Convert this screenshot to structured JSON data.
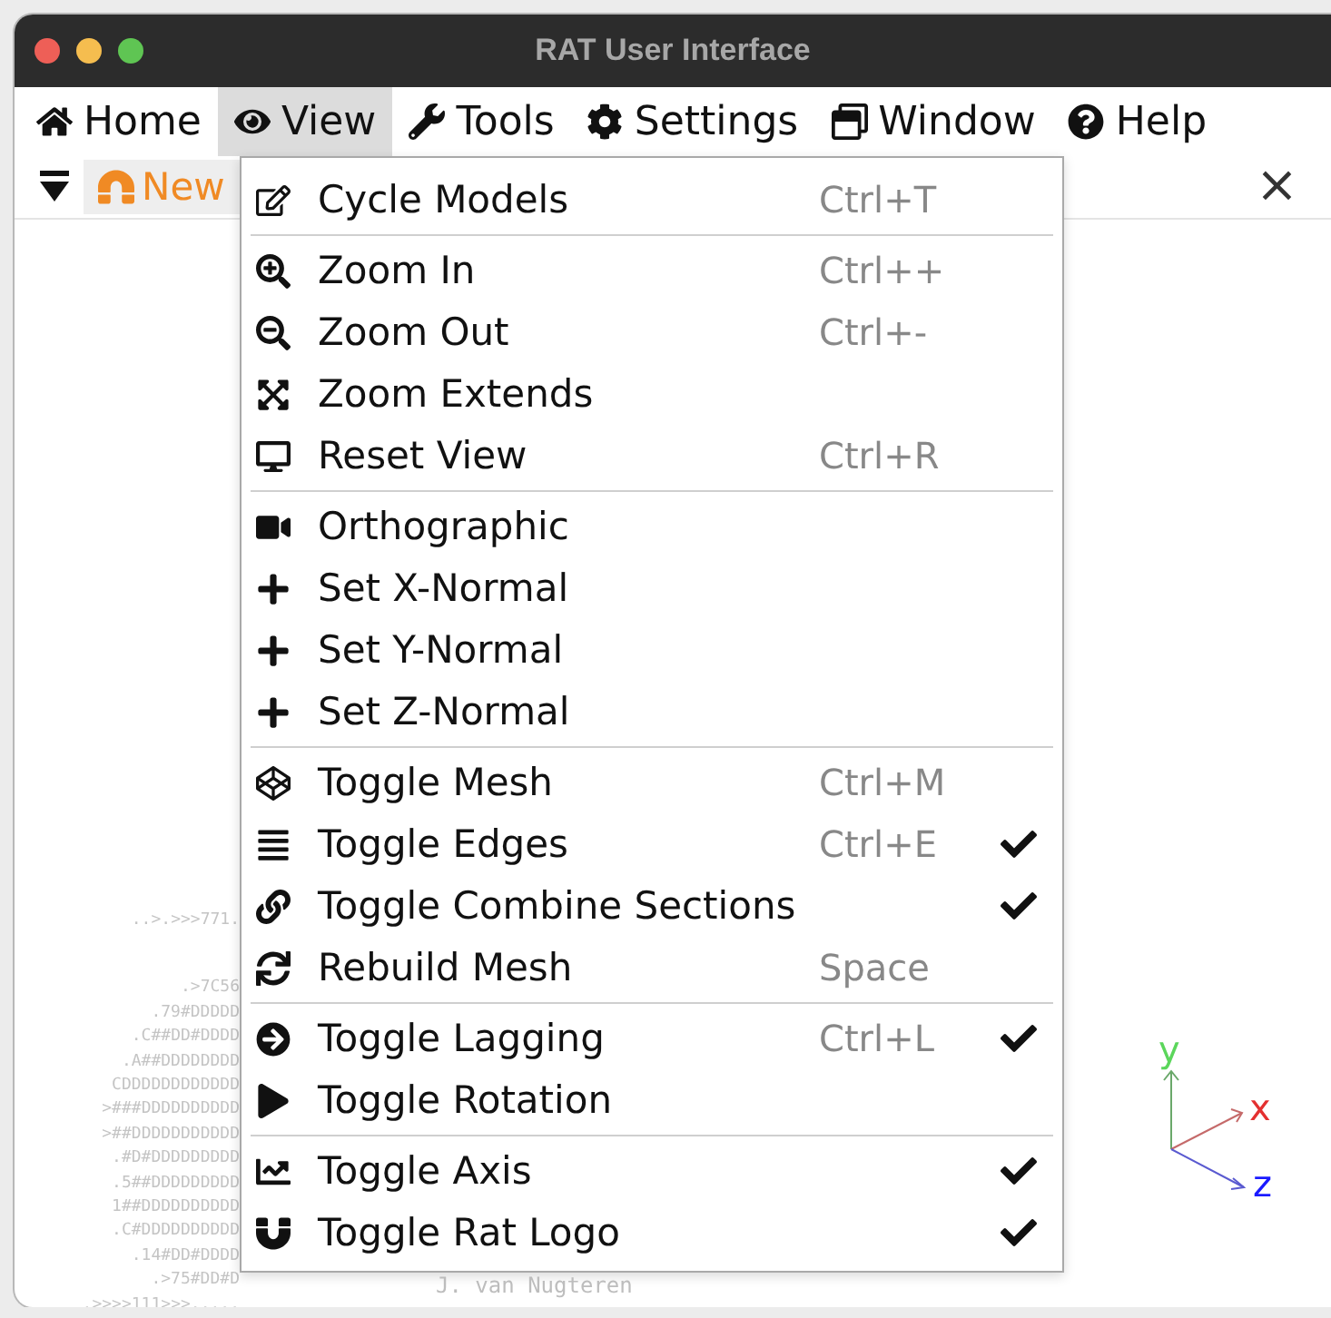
{
  "window": {
    "title": "RAT User Interface"
  },
  "menubar": [
    {
      "label": "Home",
      "selected": false
    },
    {
      "label": "View",
      "selected": true
    },
    {
      "label": "Tools",
      "selected": false
    },
    {
      "label": "Settings",
      "selected": false
    },
    {
      "label": "Window",
      "selected": false
    },
    {
      "label": "Help",
      "selected": false
    }
  ],
  "tabs": [
    {
      "label": "New",
      "selected": true
    }
  ],
  "close_label": "×",
  "background_art": [
    "..>.>>>771.",
    ".>7C56",
    ".79#DDDDD",
    ".C##DD#DDDD",
    ".A##DDDDDDDD",
    "CDDDDDDDDDDDD",
    ">###DDDDDDDDDD",
    ">##DDDDDDDDDDD",
    ".#D#DDDDDDDDD",
    ".5##DDDDDDDDD",
    "1##DDDDDDDDDD",
    ".C#DDDDDDDDDD",
    ".14#DD#DDDD",
    ".>75#DD#D",
    ".>>>>111>>>....."
  ],
  "credit": "J. van Nugteren",
  "view_menu": {
    "sections": [
      [
        {
          "label": "Cycle Models",
          "shortcut": "Ctrl+T",
          "checked": false
        }
      ],
      [
        {
          "label": "Zoom In",
          "shortcut": "Ctrl++",
          "checked": false
        },
        {
          "label": "Zoom Out",
          "shortcut": "Ctrl+-",
          "checked": false
        },
        {
          "label": "Zoom Extends",
          "checked": false
        },
        {
          "label": "Reset View",
          "shortcut": "Ctrl+R",
          "checked": false
        }
      ],
      [
        {
          "label": "Orthographic",
          "checked": false
        },
        {
          "label": "Set X-Normal",
          "checked": false
        },
        {
          "label": "Set Y-Normal",
          "checked": false
        },
        {
          "label": "Set Z-Normal",
          "checked": false
        }
      ],
      [
        {
          "label": "Toggle Mesh",
          "shortcut": "Ctrl+M",
          "checked": false
        },
        {
          "label": "Toggle Edges",
          "shortcut": "Ctrl+E",
          "checked": true
        },
        {
          "label": "Toggle Combine Sections",
          "checked": true
        },
        {
          "label": "Rebuild Mesh",
          "shortcut": "Space",
          "checked": false
        }
      ],
      [
        {
          "label": "Toggle Lagging",
          "shortcut": "Ctrl+L",
          "checked": true
        },
        {
          "label": "Toggle Rotation",
          "checked": false
        }
      ],
      [
        {
          "label": "Toggle Axis",
          "checked": true
        },
        {
          "label": "Toggle Rat Logo",
          "checked": true
        }
      ]
    ]
  },
  "axes": {
    "x": "x",
    "y": "y",
    "z": "z"
  }
}
